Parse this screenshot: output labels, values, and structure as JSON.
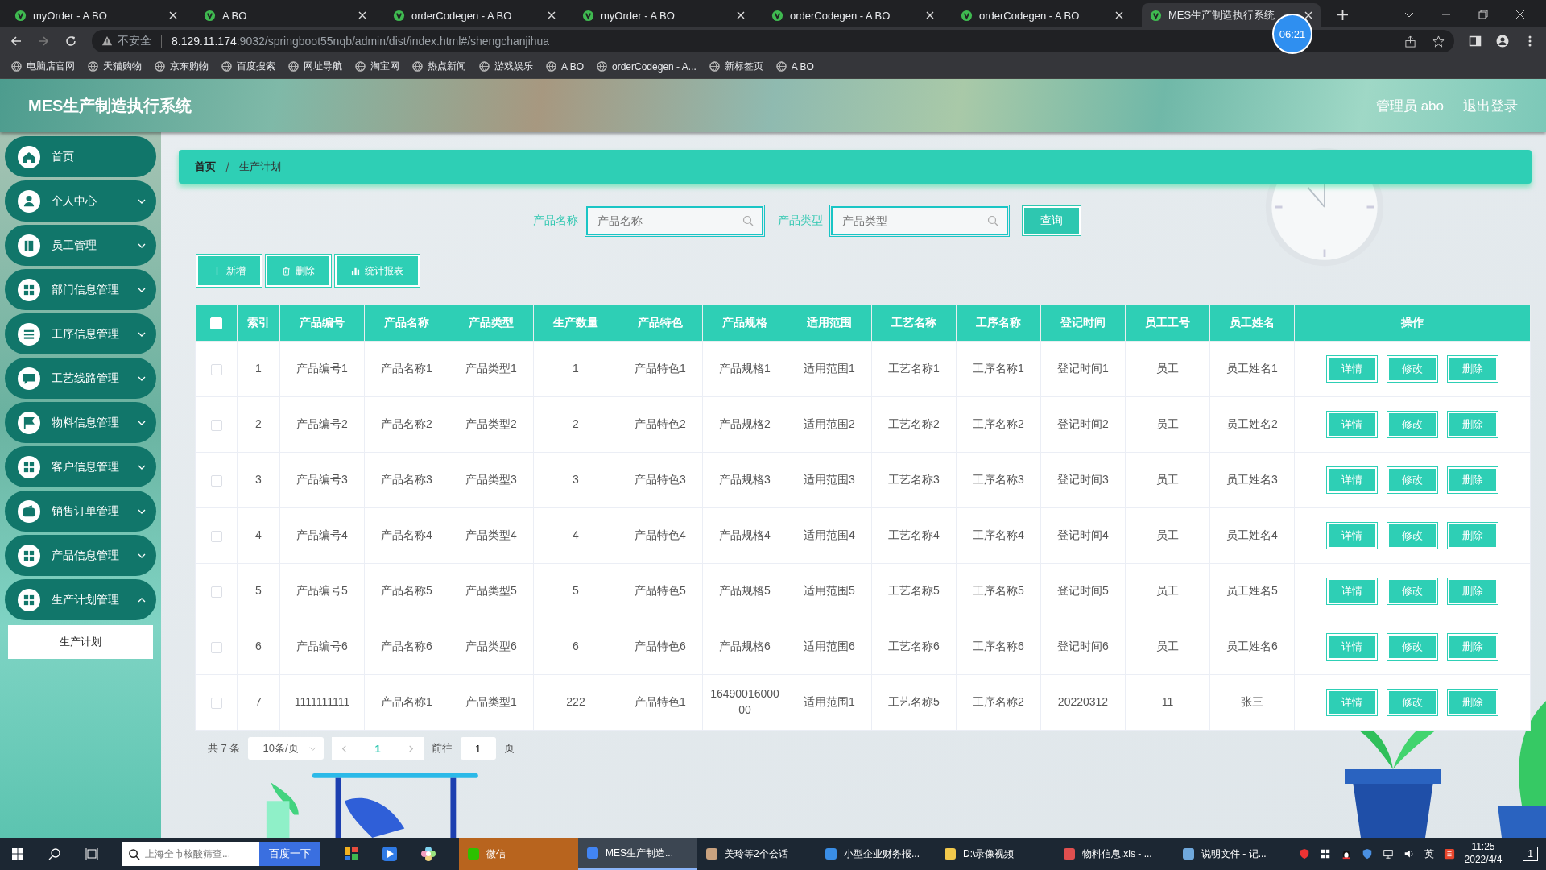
{
  "browser": {
    "tabs": [
      {
        "title": "myOrder - A BO",
        "selected": false
      },
      {
        "title": "A BO",
        "selected": false
      },
      {
        "title": "orderCodegen - A BO",
        "selected": false
      },
      {
        "title": "myOrder - A BO",
        "selected": false
      },
      {
        "title": "orderCodegen - A BO",
        "selected": false
      },
      {
        "title": "orderCodegen - A BO",
        "selected": false
      },
      {
        "title": "MES生产制造执行系统",
        "selected": true
      }
    ],
    "security": "不安全",
    "url_host": "8.129.11.174",
    "url_rest": ":9032/springboot55nqb/admin/dist/index.html#/shengchanjihua",
    "bookmarks": [
      "电脑店官网",
      "天猫购物",
      "京东购物",
      "百度搜索",
      "网址导航",
      "淘宝网",
      "热点新闻",
      "游戏娱乐",
      "A BO",
      "orderCodegen - A...",
      "新标签页",
      "A BO"
    ],
    "recorder_time": "06:21"
  },
  "app": {
    "title": "MES生产制造执行系统",
    "user": "管理员 abo",
    "logout": "退出登录"
  },
  "sidebar": {
    "items": [
      {
        "label": "首页",
        "kind": "link"
      },
      {
        "label": "个人中心",
        "kind": "menu",
        "expanded": false
      },
      {
        "label": "员工管理",
        "kind": "menu",
        "expanded": false
      },
      {
        "label": "部门信息管理",
        "kind": "menu",
        "expanded": false
      },
      {
        "label": "工序信息管理",
        "kind": "menu",
        "expanded": false
      },
      {
        "label": "工艺线路管理",
        "kind": "menu",
        "expanded": false
      },
      {
        "label": "物料信息管理",
        "kind": "menu",
        "expanded": false
      },
      {
        "label": "客户信息管理",
        "kind": "menu",
        "expanded": false
      },
      {
        "label": "销售订单管理",
        "kind": "menu",
        "expanded": false
      },
      {
        "label": "产品信息管理",
        "kind": "menu",
        "expanded": false
      },
      {
        "label": "生产计划管理",
        "kind": "menu",
        "expanded": true,
        "children": [
          {
            "label": "生产计划",
            "selected": true
          }
        ]
      }
    ]
  },
  "breadcrumb": [
    "首页",
    "生产计划"
  ],
  "search": {
    "fields": [
      {
        "label": "产品名称",
        "placeholder": "产品名称"
      },
      {
        "label": "产品类型",
        "placeholder": "产品类型"
      }
    ],
    "button": "查询"
  },
  "actions": [
    {
      "kind": "add",
      "label": "新增"
    },
    {
      "kind": "delete",
      "label": "删除"
    },
    {
      "kind": "chart",
      "label": "统计报表"
    }
  ],
  "table": {
    "header_checked": false,
    "columns": [
      "索引",
      "产品编号",
      "产品名称",
      "产品类型",
      "生产数量",
      "产品特色",
      "产品规格",
      "适用范围",
      "工艺名称",
      "工序名称",
      "登记时间",
      "员工工号",
      "员工姓名",
      "操作"
    ],
    "rows": [
      {
        "checked": false,
        "cells": [
          "1",
          "产品编号1",
          "产品名称1",
          "产品类型1",
          "1",
          "产品特色1",
          "产品规格1",
          "适用范围1",
          "工艺名称1",
          "工序名称1",
          "登记时间1",
          "员工",
          "员工姓名1"
        ],
        "actions": [
          "详情",
          "修改",
          "删除"
        ]
      },
      {
        "checked": false,
        "cells": [
          "2",
          "产品编号2",
          "产品名称2",
          "产品类型2",
          "2",
          "产品特色2",
          "产品规格2",
          "适用范围2",
          "工艺名称2",
          "工序名称2",
          "登记时间2",
          "员工",
          "员工姓名2"
        ],
        "actions": [
          "详情",
          "修改",
          "删除"
        ]
      },
      {
        "checked": false,
        "cells": [
          "3",
          "产品编号3",
          "产品名称3",
          "产品类型3",
          "3",
          "产品特色3",
          "产品规格3",
          "适用范围3",
          "工艺名称3",
          "工序名称3",
          "登记时间3",
          "员工",
          "员工姓名3"
        ],
        "actions": [
          "详情",
          "修改",
          "删除"
        ]
      },
      {
        "checked": false,
        "cells": [
          "4",
          "产品编号4",
          "产品名称4",
          "产品类型4",
          "4",
          "产品特色4",
          "产品规格4",
          "适用范围4",
          "工艺名称4",
          "工序名称4",
          "登记时间4",
          "员工",
          "员工姓名4"
        ],
        "actions": [
          "详情",
          "修改",
          "删除"
        ]
      },
      {
        "checked": false,
        "cells": [
          "5",
          "产品编号5",
          "产品名称5",
          "产品类型5",
          "5",
          "产品特色5",
          "产品规格5",
          "适用范围5",
          "工艺名称5",
          "工序名称5",
          "登记时间5",
          "员工",
          "员工姓名5"
        ],
        "actions": [
          "详情",
          "修改",
          "删除"
        ]
      },
      {
        "checked": false,
        "cells": [
          "6",
          "产品编号6",
          "产品名称6",
          "产品类型6",
          "6",
          "产品特色6",
          "产品规格6",
          "适用范围6",
          "工艺名称6",
          "工序名称6",
          "登记时间6",
          "员工",
          "员工姓名6"
        ],
        "actions": [
          "详情",
          "修改",
          "删除"
        ]
      },
      {
        "checked": false,
        "cells": [
          "7",
          "1111111111",
          "产品名称1",
          "产品类型1",
          "222",
          "产品特色1",
          "1649001600000",
          "适用范围1",
          "工艺名称5",
          "工序名称2",
          "20220312",
          "11",
          "张三"
        ],
        "actions": [
          "详情",
          "修改",
          "删除"
        ]
      }
    ]
  },
  "pagination": {
    "total": "共 7 条",
    "page_size": "10条/页",
    "pages": [
      {
        "label": "1",
        "selected": true
      }
    ],
    "goto_label": "前往",
    "goto_value": "1",
    "goto_suffix": "页"
  },
  "taskbar": {
    "search_placeholder": "上海全市核酸筛查...",
    "search_button": "百度一下",
    "apps": [
      {
        "label": "微信",
        "selected": false,
        "flashing": true
      },
      {
        "label": "MES生产制造...",
        "selected": true,
        "flashing": false
      },
      {
        "label": "美玲等2个会话",
        "selected": false,
        "flashing": false
      },
      {
        "label": "小型企业财务报...",
        "selected": false,
        "flashing": false
      },
      {
        "label": "D:\\录像视频",
        "selected": false,
        "flashing": false
      },
      {
        "label": "物料信息.xls - ...",
        "selected": false,
        "flashing": false
      },
      {
        "label": "说明文件 - 记...",
        "selected": false,
        "flashing": false
      }
    ],
    "ime": "英",
    "time": "11:25",
    "date": "2022/4/4",
    "notifications": "1"
  }
}
